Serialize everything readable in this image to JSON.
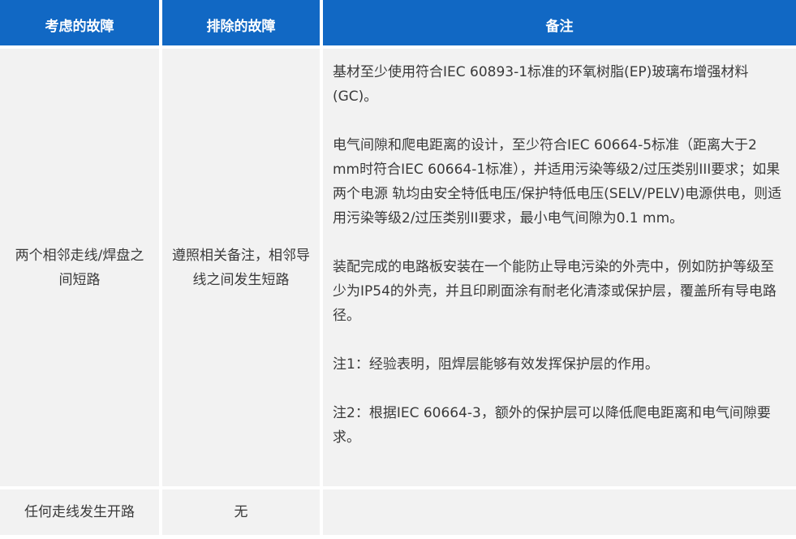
{
  "header": {
    "col1": "考虑的故障",
    "col2": "排除的故障",
    "col3": "备注"
  },
  "rows": [
    {
      "fault_considered": "两个相邻走线/焊盘之间短路",
      "fault_excluded": "遵照相关备注，相邻导线之间发生短路",
      "notes": [
        "基材至少使用符合IEC 60893-1标准的环氧树脂(EP)玻璃布增强材料(GC)。",
        "电气间隙和爬电距离的设计，至少符合IEC 60664-5标准（距离大于2 mm时符合IEC 60664-1标准），并适用污染等级2/过压类别III要求；如果两个电源 轨均由安全特低电压/保护特低电压(SELV/PELV)电源供电，则适用污染等级2/过压类别II要求，最小电气间隙为0.1 mm。",
        "装配完成的电路板安装在一个能防止导电污染的外壳中，例如防护等级至少为IP54的外壳，并且印刷面涂有耐老化清漆或保护层，覆盖所有导电路径。",
        "注1：经验表明，阻焊层能够有效发挥保护层的作用。",
        "注2：根据IEC 60664-3，额外的保护层可以降低爬电距离和电气间隙要求。"
      ]
    },
    {
      "fault_considered": "任何走线发生开路",
      "fault_excluded": "无",
      "notes": []
    }
  ],
  "colors": {
    "header_bg": "#1168c4",
    "header_text": "#ffffff",
    "cell_bg": "#f2f2f2",
    "text": "#3a3a3a"
  }
}
